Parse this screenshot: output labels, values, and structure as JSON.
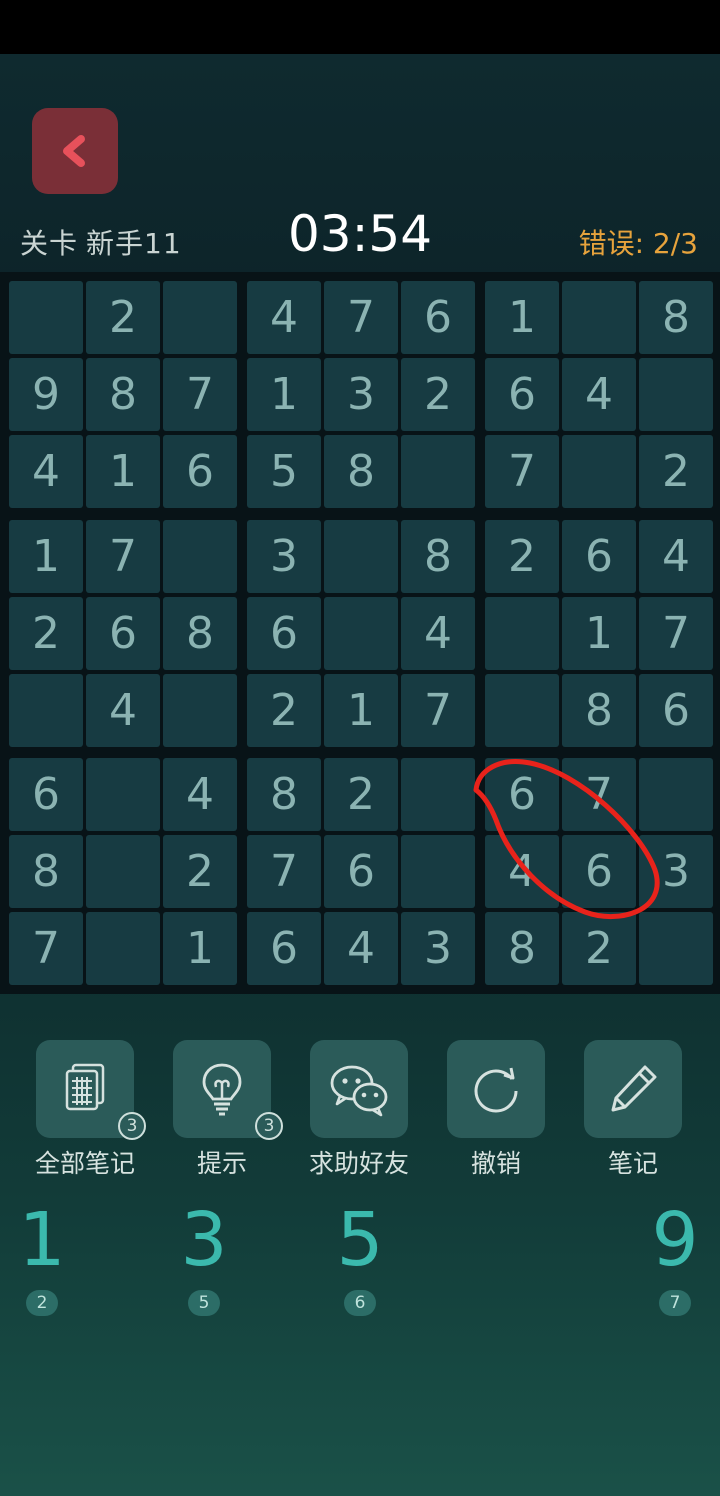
{
  "header": {
    "level_label": "关卡",
    "level_name": "新手11",
    "timer": "03:54",
    "errors": "错误: 2/3"
  },
  "board": {
    "rows": [
      [
        "",
        "2",
        "",
        "4",
        "7",
        "6",
        "1",
        "",
        "8"
      ],
      [
        "9",
        "8",
        "7",
        "1",
        "3",
        "2",
        "6",
        "4",
        ""
      ],
      [
        "4",
        "1",
        "6",
        "5",
        "8",
        "",
        "7",
        "",
        "2"
      ],
      [
        "1",
        "7",
        "",
        "3",
        "",
        "8",
        "2",
        "6",
        "4"
      ],
      [
        "2",
        "6",
        "8",
        "6",
        "",
        "4",
        "",
        "1",
        "7"
      ],
      [
        "",
        "4",
        "",
        "2",
        "1",
        "7",
        "",
        "8",
        "6"
      ],
      [
        "6",
        "",
        "4",
        "8",
        "2",
        "",
        "6",
        "7",
        ""
      ],
      [
        "8",
        "",
        "2",
        "7",
        "6",
        "",
        "4",
        "6",
        "3"
      ],
      [
        "7",
        "",
        "1",
        "6",
        "4",
        "3",
        "8",
        "2",
        ""
      ]
    ]
  },
  "annotation": {
    "color": "#e8231b"
  },
  "tools": [
    {
      "label": "全部笔记",
      "icon": "notes-grid-icon",
      "badge": "3"
    },
    {
      "label": "提示",
      "icon": "lightbulb-icon",
      "badge": "3"
    },
    {
      "label": "求助好友",
      "icon": "wechat-icon",
      "badge": ""
    },
    {
      "label": "撤销",
      "icon": "undo-icon",
      "badge": ""
    },
    {
      "label": "笔记",
      "icon": "pencil-icon",
      "badge": ""
    }
  ],
  "numpad": [
    {
      "digit": "1",
      "count": "2"
    },
    {
      "digit": "3",
      "count": "5"
    },
    {
      "digit": "5",
      "count": "6"
    },
    {
      "digit": "9",
      "count": "7"
    }
  ],
  "colors": {
    "background": "#0b1f25",
    "cell": "#173b42",
    "digit": "#8bb3b2",
    "timer": "#ffffff",
    "errors": "#e7a33c",
    "numpad_digit": "#3bb9ad",
    "back_button": "#7a2f37"
  }
}
